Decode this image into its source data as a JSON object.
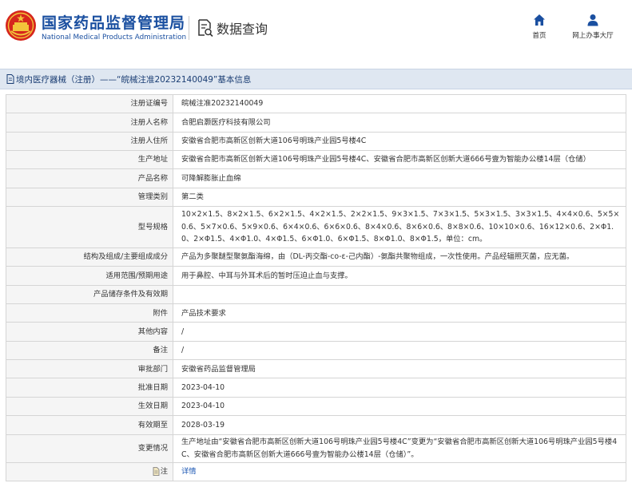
{
  "header": {
    "org_cn": "国家药品监督管理局",
    "org_en": "National Medical Products Administration",
    "section": "数据查询",
    "nav": [
      {
        "label": "首页",
        "icon": "home-icon"
      },
      {
        "label": "网上办事大厅",
        "icon": "user-icon"
      }
    ]
  },
  "breadcrumb": "境内医疗器械（注册）——“皖械注准20232140049”基本信息",
  "rows": [
    {
      "label": "注册证编号",
      "value": "皖械注准20232140049"
    },
    {
      "label": "注册人名称",
      "value": "合肥启灏医疗科技有限公司"
    },
    {
      "label": "注册人住所",
      "value": "安徽省合肥市高新区创新大道106号明珠产业园5号楼4C"
    },
    {
      "label": "生产地址",
      "value": "安徽省合肥市高新区创新大道106号明珠产业园5号楼4C、安徽省合肥市高新区创新大道666号壹为智能办公楼14层（仓储）"
    },
    {
      "label": "产品名称",
      "value": "可降解膨胀止血绵"
    },
    {
      "label": "管理类别",
      "value": "第二类"
    },
    {
      "label": "型号规格",
      "value": "10×2×1.5、8×2×1.5、6×2×1.5、4×2×1.5、2×2×1.5、9×3×1.5、7×3×1.5、5×3×1.5、3×3×1.5、4×4×0.6、5×5×0.6、5×7×0.6、5×9×0.6、6×4×0.6、6×6×0.6、8×4×0.6、8×6×0.6、8×8×0.6、10×10×0.6、16×12×0.6、2×Φ1.0、2×Φ1.5、4×Φ1.0、4×Φ1.5、6×Φ1.0、6×Φ1.5、8×Φ1.0、8×Φ1.5，单位：cm。"
    },
    {
      "label": "结构及组成/主要组成成分",
      "value": "产品为多聚醚型聚氨酯海绵，由（DL-丙交酯-co-ε-己内酯）-氨酯共聚物组成，一次性使用。产品经辐照灭菌，应无菌。"
    },
    {
      "label": "适用范围/预期用途",
      "value": "用于鼻腔、中耳与外耳术后的暂时压迫止血与支撑。"
    },
    {
      "label": "产品储存条件及有效期",
      "value": ""
    },
    {
      "label": "附件",
      "value": "产品技术要求"
    },
    {
      "label": "其他内容",
      "value": "/"
    },
    {
      "label": "备注",
      "value": "/"
    },
    {
      "label": "审批部门",
      "value": "安徽省药品监督管理局"
    },
    {
      "label": "批准日期",
      "value": "2023-04-10"
    },
    {
      "label": "生效日期",
      "value": "2023-04-10"
    },
    {
      "label": "有效期至",
      "value": "2028-03-19"
    },
    {
      "label": "变更情况",
      "value": "生产地址由“安徽省合肥市高新区创新大道106号明珠产业园5号楼4C”变更为“安徽省合肥市高新区创新大道106号明珠产业园5号楼4C、安徽省合肥市高新区创新大道666号壹为智能办公楼14层（仓储）”。"
    },
    {
      "label": "注",
      "value": "详情"
    }
  ]
}
